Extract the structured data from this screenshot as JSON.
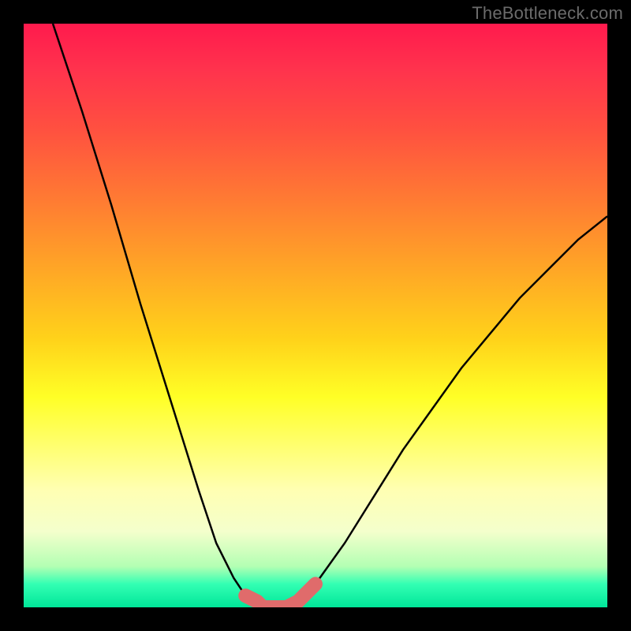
{
  "watermark": "TheBottleneck.com",
  "colors": {
    "frame": "#000000",
    "curve": "#000000",
    "highlight": "#e06b6b",
    "gradient_top": "#ff1a4d",
    "gradient_bottom": "#00e699"
  },
  "chart_data": {
    "type": "line",
    "title": "",
    "xlabel": "",
    "ylabel": "",
    "xlim": [
      0,
      100
    ],
    "ylim": [
      0,
      100
    ],
    "legend": false,
    "grid": false,
    "annotations": [],
    "series": [
      {
        "name": "left-branch",
        "x": [
          5,
          10,
          15,
          20,
          25,
          30,
          33,
          36,
          38,
          40,
          41
        ],
        "values": [
          100,
          85,
          69,
          52,
          36,
          20,
          11,
          5,
          2,
          1,
          0
        ]
      },
      {
        "name": "right-branch",
        "x": [
          45,
          47,
          50,
          55,
          60,
          65,
          70,
          75,
          80,
          85,
          90,
          95,
          100
        ],
        "values": [
          0,
          1,
          4,
          11,
          19,
          27,
          34,
          41,
          47,
          53,
          58,
          63,
          67
        ]
      }
    ],
    "highlights": [
      {
        "name": "dip-left-segment",
        "x": [
          38,
          40,
          41
        ],
        "values": [
          2,
          1,
          0
        ]
      },
      {
        "name": "dip-bottom-segment",
        "x": [
          41,
          45
        ],
        "values": [
          0,
          0
        ]
      },
      {
        "name": "dip-right-segment",
        "x": [
          45,
          47,
          50
        ],
        "values": [
          0,
          1,
          4
        ]
      }
    ]
  }
}
